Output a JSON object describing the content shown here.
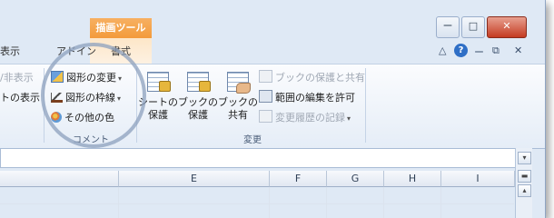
{
  "context_tab": {
    "title": "描画ツール"
  },
  "tabs": [
    {
      "label": "表示"
    },
    {
      "label": "アドイン"
    },
    {
      "label": "書式"
    }
  ],
  "window_controls": {
    "minimize": "ー",
    "restore": "□",
    "close": "✕"
  },
  "help_bar": {
    "caret": "△",
    "help": "?",
    "min": "ー",
    "restore": "⧉",
    "close": "✕"
  },
  "comment_group": {
    "label": "コメント",
    "left_items": [
      {
        "label": "/非表示",
        "disabled": true
      },
      {
        "label": "トの表示",
        "disabled": false
      }
    ],
    "items": [
      {
        "label": "図形の変更",
        "icon": "shape-change-icon",
        "dropdown": true
      },
      {
        "label": "図形の枠線",
        "icon": "shape-outline-icon",
        "dropdown": true
      },
      {
        "label": "その他の色",
        "icon": "palette-icon",
        "dropdown": false
      }
    ]
  },
  "changes_group": {
    "label": "変更",
    "big_buttons": [
      {
        "line1": "シートの",
        "line2": "保護",
        "icon": "protect-sheet-icon"
      },
      {
        "line1": "ブックの",
        "line2": "保護",
        "icon": "protect-workbook-icon"
      },
      {
        "line1": "ブックの",
        "line2": "共有",
        "icon": "share-workbook-icon"
      }
    ],
    "small_buttons": [
      {
        "label": "ブックの保護と共有",
        "disabled": true,
        "icon": "protect-share-icon"
      },
      {
        "label": "範囲の編集を許可",
        "disabled": false,
        "icon": "allow-edit-ranges-icon"
      },
      {
        "label": "変更履歴の記録",
        "disabled": true,
        "dropdown": true,
        "icon": "track-changes-icon"
      }
    ]
  },
  "columns": [
    "E",
    "F",
    "G",
    "H",
    "I"
  ],
  "colors": {
    "context_tab": "#f39b3b",
    "ribbon": "#e5edf7",
    "help": "#2f6fc6"
  }
}
